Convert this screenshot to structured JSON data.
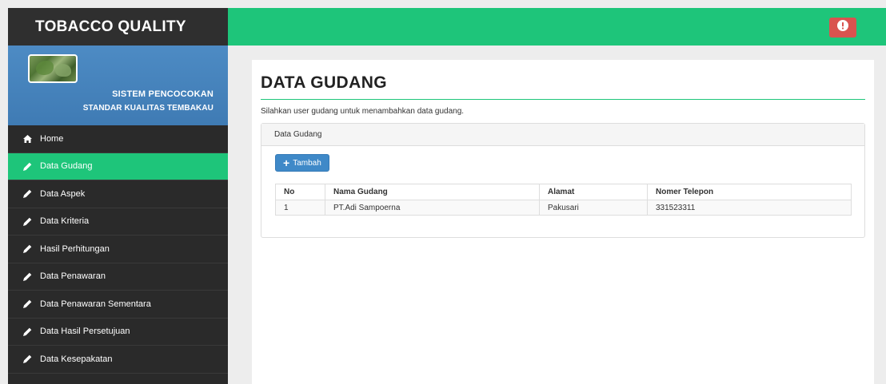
{
  "brand": "TOBACCO QUALITY",
  "profile": {
    "line1": "SISTEM PENCOCOKAN",
    "line2": "STANDAR KUALITAS TEMBAKAU"
  },
  "menu": [
    {
      "label": "Home",
      "icon": "home-icon"
    },
    {
      "label": "Data Gudang",
      "icon": "pencil-icon"
    },
    {
      "label": "Data Aspek",
      "icon": "pencil-icon"
    },
    {
      "label": "Data Kriteria",
      "icon": "pencil-icon"
    },
    {
      "label": "Hasil Perhitungan",
      "icon": "pencil-icon"
    },
    {
      "label": "Data Penawaran",
      "icon": "pencil-icon"
    },
    {
      "label": "Data Penawaran Sementara",
      "icon": "pencil-icon"
    },
    {
      "label": "Data Hasil Persetujuan",
      "icon": "pencil-icon"
    },
    {
      "label": "Data Kesepakatan",
      "icon": "pencil-icon"
    }
  ],
  "page": {
    "title": "DATA GUDANG",
    "subtitle": "Silahkan user gudang untuk menambahkan data gudang."
  },
  "card": {
    "heading": "Data Gudang",
    "add_label": "Tambah"
  },
  "table": {
    "headers": [
      "No",
      "Nama Gudang",
      "Alamat",
      "Nomer Telepon"
    ],
    "rows": [
      [
        "1",
        "PT.Adi Sampoerna",
        "Pakusari",
        "331523311"
      ]
    ]
  },
  "colors": {
    "accent": "#1ec57a",
    "sidebar": "#2a2a2a",
    "primary_button": "#3f89c8",
    "alert_button": "#d9534f"
  }
}
